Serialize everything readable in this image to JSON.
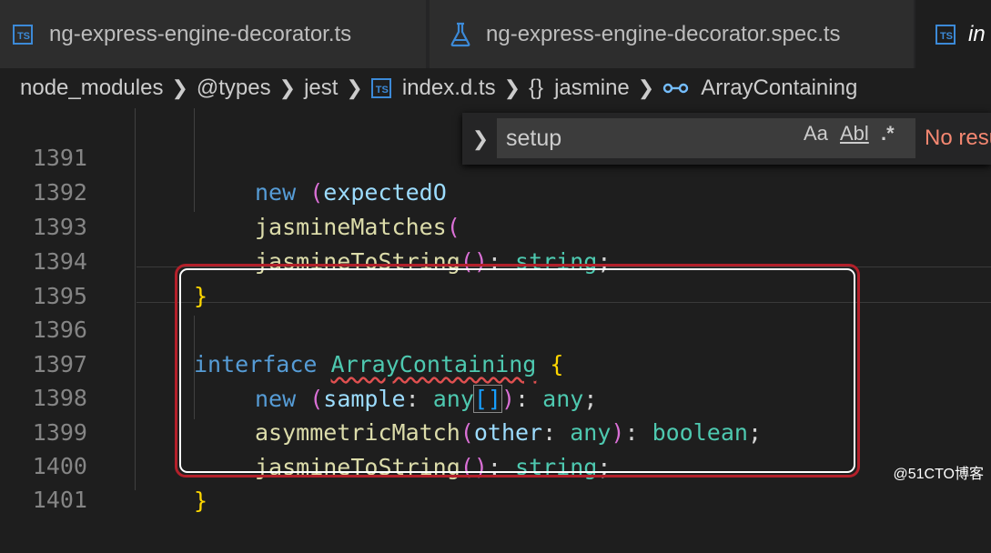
{
  "tabs": [
    {
      "label": "ng-express-engine-decorator.ts",
      "icon": "ts-file-icon",
      "icon_text": "TS"
    },
    {
      "label": "ng-express-engine-decorator.spec.ts",
      "icon": "flask-icon"
    },
    {
      "label": "in",
      "icon": "ts-file-icon",
      "icon_text": "TS"
    }
  ],
  "breadcrumb": {
    "items": [
      "node_modules",
      "@types",
      "jest",
      "index.d.ts",
      "jasmine",
      "ArrayContaining"
    ],
    "braces": "{}"
  },
  "find": {
    "query": "setup",
    "match_case": "Aa",
    "whole_word": "Abl",
    "regex": ".*",
    "status": "No resu"
  },
  "line_numbers": [
    "1391",
    "1392",
    "1393",
    "1394",
    "1395",
    "1396",
    "1397",
    "1398",
    "1399",
    "1400",
    "1401"
  ],
  "code": {
    "l1391": {
      "kw": "new",
      "open": "(",
      "name": "expectedO"
    },
    "l1392": {
      "fn": "jasmineMatches",
      "open": "("
    },
    "l1393": {
      "fn": "jasmineToString",
      "parens": "()",
      "colon": ":",
      "type": "string",
      "semi": ";"
    },
    "l1394": {
      "brace": "}"
    },
    "l1396": {
      "kw": "interface",
      "name": "ArrayContaining",
      "brace": "{"
    },
    "l1397": {
      "kw": "new",
      "open": "(",
      "param": "sample",
      "colon": ":",
      "type": "any",
      "arr": "[]",
      "close": ")",
      "colon2": ":",
      "ret": "any",
      "semi": ";"
    },
    "l1398": {
      "fn": "asymmetricMatch",
      "open": "(",
      "param": "other",
      "colon": ":",
      "type": "any",
      "close": ")",
      "colon2": ":",
      "ret": "boolean",
      "semi": ";"
    },
    "l1399": {
      "fn": "jasmineToString",
      "parens": "()",
      "colon": ":",
      "type": "string",
      "semi": ";"
    },
    "l1400": {
      "brace": "}"
    }
  },
  "watermark": "@51CTO博客",
  "colors": {
    "keyword": "#569cd6",
    "type": "#4ec9b0",
    "function": "#dcdcaa",
    "param": "#9cdcfe",
    "bracket": "#da70d6",
    "annotation": "#b3202a"
  }
}
